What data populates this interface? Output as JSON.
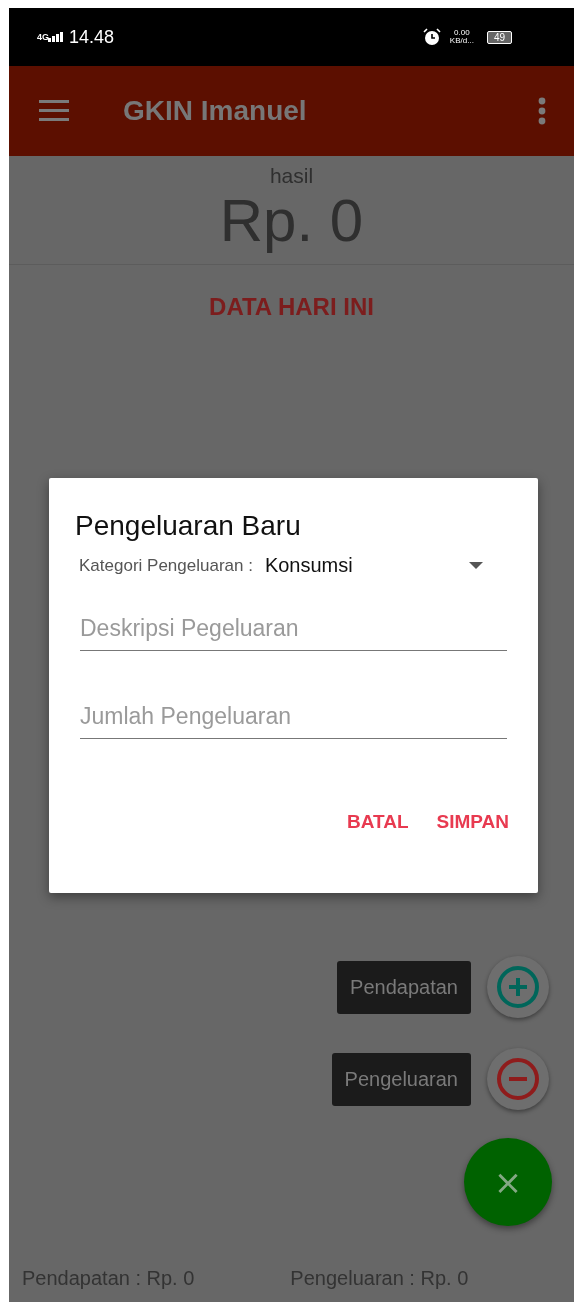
{
  "status_bar": {
    "network": "4G",
    "time": "14.48",
    "speed_value": "0.00",
    "speed_unit": "KB/d...",
    "battery": "49"
  },
  "app_bar": {
    "title": "GKIN Imanuel"
  },
  "summary": {
    "label": "hasil",
    "amount": "Rp. 0"
  },
  "section_title": "DATA HARI INI",
  "dialog": {
    "title": "Pengeluaran Baru",
    "category": {
      "label": "Kategori Pengeluaran :",
      "value": "Konsumsi"
    },
    "fields": [
      {
        "placeholder": "Deskripsi Pegeluaran"
      },
      {
        "placeholder": "Jumlah Pengeluaran"
      }
    ],
    "buttons": [
      "BATAL",
      "SIMPAN"
    ]
  },
  "fab_actions": [
    {
      "label": "Pendapatan",
      "kind": "plus"
    },
    {
      "label": "Pengeluaran",
      "kind": "minus"
    }
  ],
  "fab": {
    "symbol": "×"
  },
  "footer": [
    "Pendapatan : Rp. 0",
    "Pengeluaran : Rp. 0"
  ]
}
